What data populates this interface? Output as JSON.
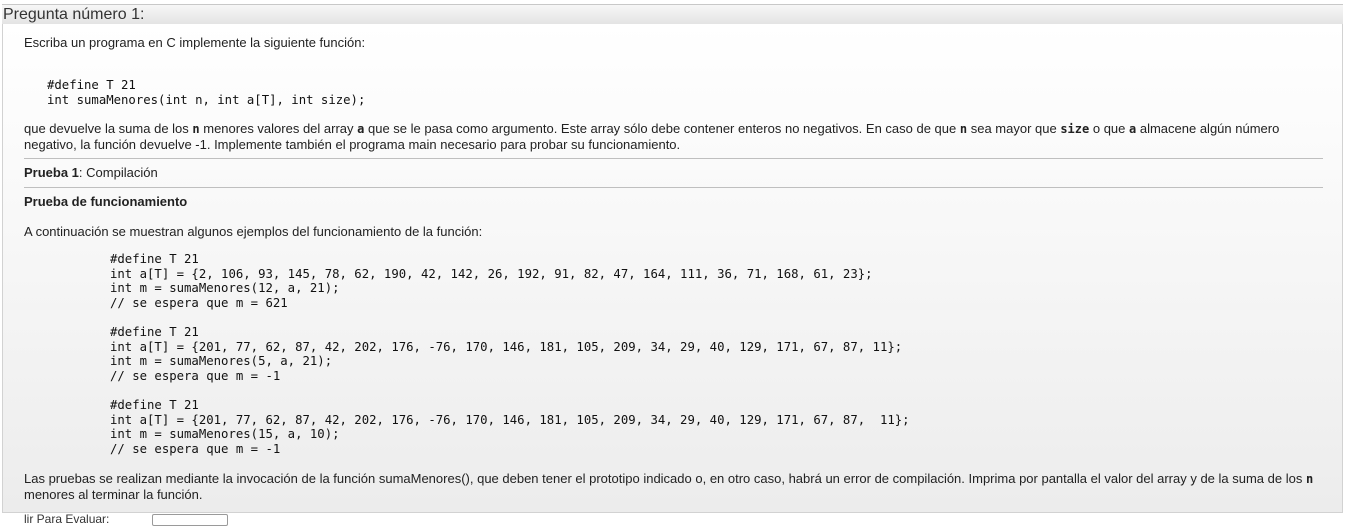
{
  "question": {
    "title": "Pregunta número 1:",
    "intro": "Escriba un programa en C implemente la siguiente función:",
    "prototype_code": "#define T 21\nint sumaMenores(int n, int a[T], int size);",
    "desc": {
      "t1": "que devuelve la suma de los ",
      "n1": "n",
      "t2": " menores valores del array ",
      "a1": "a",
      "t3": " que se le pasa como argumento. Este array sólo debe contener enteros no negativos. En caso de que ",
      "n2": "n",
      "t4": " sea mayor que ",
      "size": "size",
      "t5": " o que ",
      "a2": "a",
      "t6": " almacene algún número negativo, la función devuelve -1. Implemente también el programa main necesario para probar su funcionamiento."
    },
    "test1": {
      "label": "Prueba 1",
      "rest": ": Compilación"
    },
    "test2": {
      "heading": "Prueba de funcionamiento"
    },
    "examples_intro": "A continuación se muestran algunos ejemplos del funcionamiento de la función:",
    "examples": [
      "#define T 21\nint a[T] = {2, 106, 93, 145, 78, 62, 190, 42, 142, 26, 192, 91, 82, 47, 164, 111, 36, 71, 168, 61, 23};\nint m = sumaMenores(12, a, 21);\n// se espera que m = 621",
      "#define T 21\nint a[T] = {201, 77, 62, 87, 42, 202, 176, -76, 170, 146, 181, 105, 209, 34, 29, 40, 129, 171, 67, 87, 11};\nint m = sumaMenores(5, a, 21);\n// se espera que m = -1",
      "#define T 21\nint a[T] = {201, 77, 62, 87, 42, 202, 176, -76, 170, 146, 181, 105, 209, 34, 29, 40, 129, 171, 67, 87,  11};\nint m = sumaMenores(15, a, 10);\n// se espera que m = -1"
    ],
    "closing": {
      "t1": "Las pruebas se realizan mediante la invocación de la función sumaMenores(), que deben tener el prototipo indicado o, en otro caso, habrá un error de compilación. Imprima por pantalla el valor del array y de la suma de los ",
      "n": "n",
      "t2": " menores al terminar la función."
    }
  },
  "footer": {
    "label": "lir Para Evaluar:"
  }
}
